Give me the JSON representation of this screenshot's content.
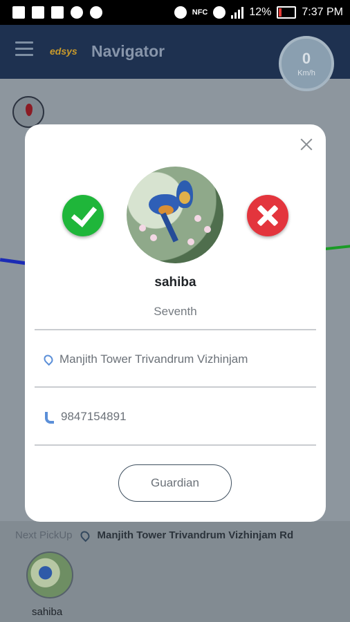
{
  "status_bar": {
    "nfc": "NFC",
    "battery": "12%",
    "time": "7:37 PM"
  },
  "header": {
    "brand": "edsys",
    "title": "Navigator",
    "speed_value": "0",
    "speed_unit": "Km/h"
  },
  "dialog": {
    "student_name": "sahiba",
    "class": "Seventh",
    "address": "Manjith Tower  Trivandrum Vizhinjam",
    "phone": "9847154891",
    "guardian_button": "Guardian"
  },
  "bottom_sheet": {
    "next_label": "Next PickUp",
    "next_address": "Manjith Tower  Trivandrum Vizhinjam Rd",
    "student_name": "sahiba"
  },
  "colors": {
    "header_bg": "#1e3150",
    "accept": "#1fb63a",
    "reject": "#e3353d",
    "accent_icon": "#5b8fd8"
  }
}
